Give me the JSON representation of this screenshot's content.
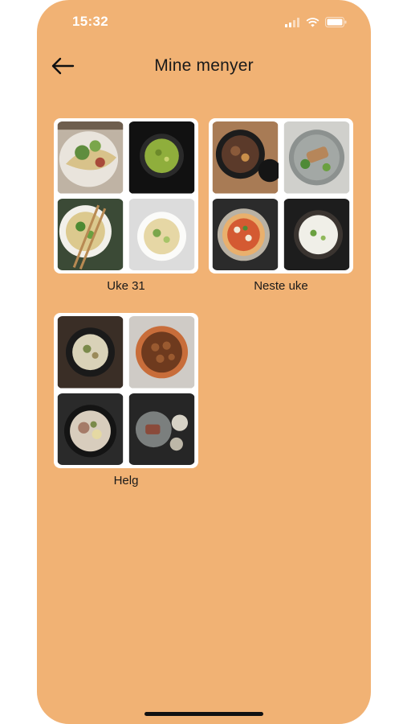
{
  "status_bar": {
    "time": "15:32"
  },
  "header": {
    "title": "Mine menyer"
  },
  "menus": [
    {
      "label": "Uke 31",
      "dishes": [
        "taco-plate",
        "green-soup",
        "noodle-bowl",
        "light-soup"
      ]
    },
    {
      "label": "Neste uke",
      "dishes": [
        "braised-pot",
        "grilled-salad",
        "pizza",
        "creamy-soup"
      ]
    },
    {
      "label": "Helg",
      "dishes": [
        "noodle-pan",
        "meatball-pot",
        "stew-pan",
        "steak-plate"
      ]
    }
  ],
  "colors": {
    "background": "#F1B274",
    "card": "#FFFFFF",
    "text": "#1A1A1A",
    "status_text": "#FFFFFF"
  }
}
